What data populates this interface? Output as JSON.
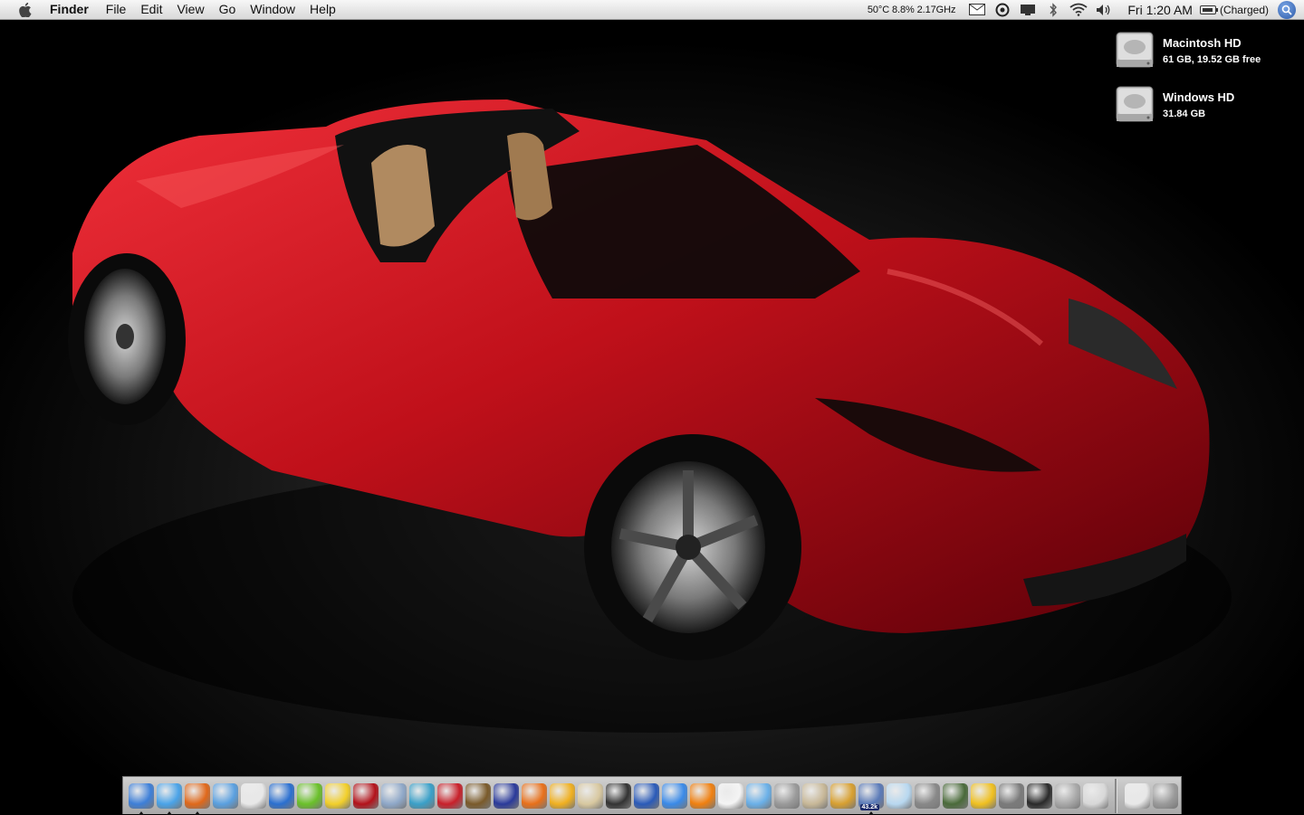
{
  "menubar": {
    "app_name": "Finder",
    "menus": [
      "File",
      "Edit",
      "View",
      "Go",
      "Window",
      "Help"
    ],
    "system_stats": "50°C 8.8% 2.17GHz",
    "clock": "Fri 1:20 AM",
    "battery_status": "(Charged)",
    "status_icons": [
      "mail-icon",
      "sync-icon",
      "display-icon",
      "bluetooth-icon",
      "wifi-icon",
      "volume-icon"
    ]
  },
  "desktop": {
    "drives": [
      {
        "name": "Macintosh HD",
        "info": "61 GB, 19.52 GB free"
      },
      {
        "name": "Windows HD",
        "info": "31.84 GB"
      }
    ]
  },
  "dock": {
    "apps": [
      {
        "icon": "finder-icon",
        "color": "#3d7fd8",
        "running": true
      },
      {
        "icon": "ichat-icon",
        "color": "#4aa3e8",
        "running": true
      },
      {
        "icon": "firefox-icon",
        "color": "#e0681a",
        "running": true
      },
      {
        "icon": "safari-icon",
        "color": "#5aa0e0",
        "running": false
      },
      {
        "icon": "textedit-icon",
        "color": "#e8e8e8",
        "running": false
      },
      {
        "icon": "word-icon",
        "color": "#2a6fd0",
        "running": false
      },
      {
        "icon": "dreamweaver-icon",
        "color": "#6ac02a",
        "running": false
      },
      {
        "icon": "adium-duck-icon",
        "color": "#f2cf2a",
        "running": false
      },
      {
        "icon": "photobooth-icon",
        "color": "#b3121a",
        "running": false
      },
      {
        "icon": "preview-icon",
        "color": "#8fa8c8",
        "running": false
      },
      {
        "icon": "quill-icon",
        "color": "#3aa0c8",
        "running": false
      },
      {
        "icon": "acrobat-icon",
        "color": "#c8202a",
        "running": false
      },
      {
        "icon": "iphoto-icon",
        "color": "#7a5a2a",
        "running": false
      },
      {
        "icon": "film-strip-icon",
        "color": "#2a3a9a",
        "running": false
      },
      {
        "icon": "ftp-icon",
        "color": "#e8701a",
        "running": false
      },
      {
        "icon": "dvd-player-icon",
        "color": "#f0b020",
        "running": false
      },
      {
        "icon": "disc-icon",
        "color": "#d8c8a0",
        "running": false
      },
      {
        "icon": "clapper-icon",
        "color": "#333333",
        "running": false
      },
      {
        "icon": "final-cut-icon",
        "color": "#2a5ab8",
        "running": false
      },
      {
        "icon": "quicktime-icon",
        "color": "#3a8ae8",
        "running": false
      },
      {
        "icon": "vlc-icon",
        "color": "#f08010",
        "running": false
      },
      {
        "icon": "calendar-icon",
        "color": "#f4f4f4",
        "running": false
      },
      {
        "icon": "itunes-icon",
        "color": "#6ab0e8",
        "running": false
      },
      {
        "icon": "disk-utility-icon",
        "color": "#9a9a9a",
        "running": false
      },
      {
        "icon": "contacts-icon",
        "color": "#c8b898",
        "running": false
      },
      {
        "icon": "garageband-icon",
        "color": "#d8a030",
        "running": false
      },
      {
        "icon": "activity-icon",
        "color": "#5a7ab8",
        "running": true,
        "badge": "43.2k"
      },
      {
        "icon": "orb-icon",
        "color": "#b8d8f0",
        "running": false
      },
      {
        "icon": "wireless-icon",
        "color": "#888888",
        "running": false
      },
      {
        "icon": "alien-icon",
        "color": "#4a6a3a",
        "running": false
      },
      {
        "icon": "rings-icon",
        "color": "#f0c020",
        "running": false
      },
      {
        "icon": "time-machine-icon",
        "color": "#7a7a7a",
        "running": false
      },
      {
        "icon": "terminal-icon",
        "color": "#2a2a2a",
        "running": false
      },
      {
        "icon": "printer-icon",
        "color": "#a8a8a8",
        "running": false
      },
      {
        "icon": "system-prefs-icon",
        "color": "#d8d8d8",
        "running": false
      }
    ],
    "trailing": [
      {
        "icon": "documents-stack-icon",
        "color": "#e8e8e8"
      },
      {
        "icon": "trash-icon",
        "color": "#9a9a9a"
      }
    ]
  }
}
